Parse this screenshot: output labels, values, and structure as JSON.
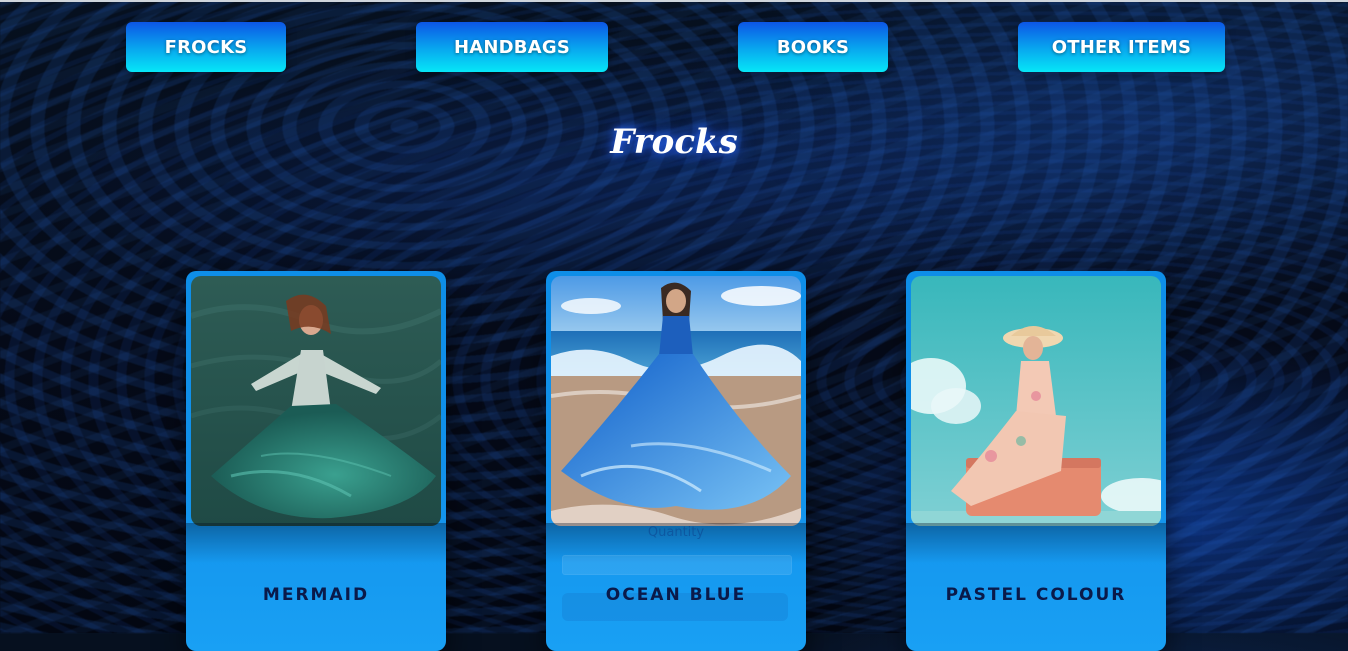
{
  "nav": {
    "frocks": "FROCKS",
    "handbags": "HANDBAGS",
    "books": "BOOKS",
    "other": "OTHER ITEMS"
  },
  "page": {
    "title": "Frocks"
  },
  "products": [
    {
      "name": "MERMAID"
    },
    {
      "name": "OCEAN BLUE",
      "quantity_label": "Quantity"
    },
    {
      "name": "PASTEL COLOUR"
    }
  ],
  "colors": {
    "nav_gradient_top": "#0c56e6",
    "nav_gradient_bottom": "#06e7f7",
    "card_blue": "#0e8ee8",
    "product_text": "#0a1a4a",
    "title_glow": "#2864ff"
  }
}
